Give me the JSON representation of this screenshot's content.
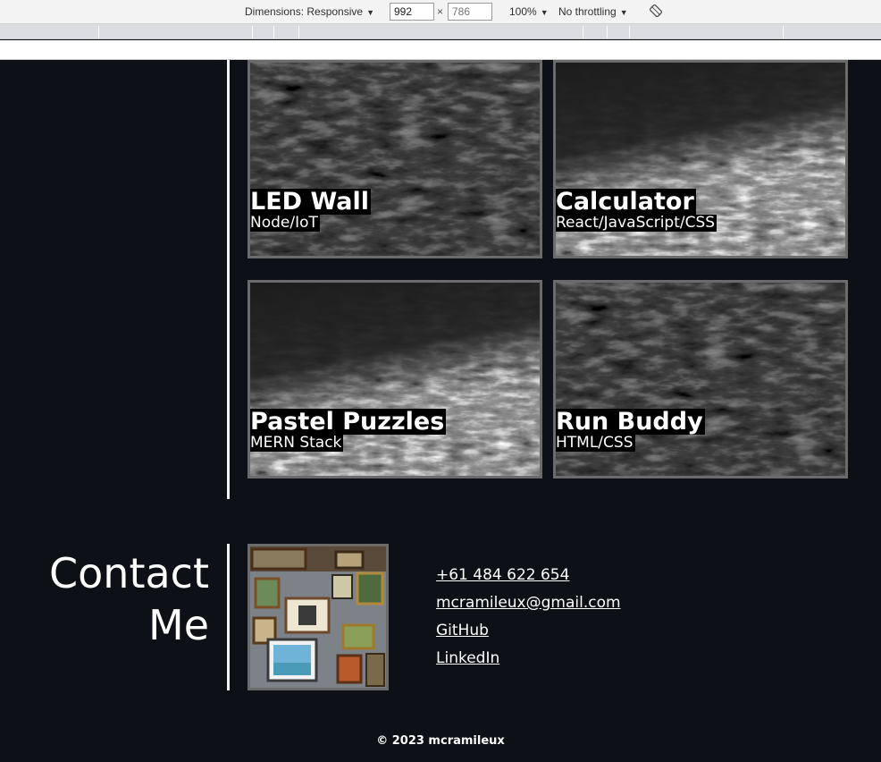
{
  "devtools": {
    "dimensions_label": "Dimensions: Responsive",
    "width_value": "992",
    "times": "×",
    "height_placeholder": "786",
    "zoom_label": "100%",
    "throttle_label": "No throttling",
    "dropdown_arrow": "▼"
  },
  "projects": [
    {
      "title": "LED Wall",
      "subtitle": "Node/IoT"
    },
    {
      "title": "Calculator",
      "subtitle": "React/JavaScript/CSS"
    },
    {
      "title": "Pastel Puzzles",
      "subtitle": "MERN Stack"
    },
    {
      "title": "Run Buddy",
      "subtitle": "HTML/CSS"
    }
  ],
  "contact": {
    "heading_line1": "Contact",
    "heading_line2": "Me",
    "phone": "+61 484 622 654",
    "email": "mcramileux@gmail.com",
    "github": "GitHub",
    "linkedin": "LinkedIn"
  },
  "footer": {
    "copyright": "© 2023 mcramileux"
  }
}
